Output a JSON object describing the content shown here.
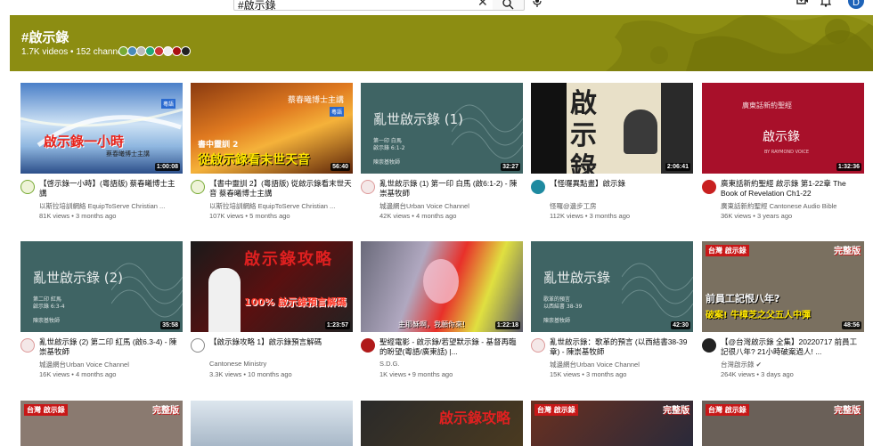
{
  "search": {
    "value": "#啟示錄"
  },
  "header": {
    "avatar_letter": "D"
  },
  "banner": {
    "title": "#啟示錄",
    "meta": "1.7K videos • 152 channels",
    "color": "#8c8d12"
  },
  "videos": [
    {
      "title": "【啓示錄一小時】(粵語版) 蔡春曦博士主講",
      "channel": "以斯拉培訓網絡 EquipToServe Christian ...",
      "meta": "81K views • 3 months ago",
      "duration": "1:00:08",
      "thumb_text": "啟示錄一小時",
      "thumb_sub": "蔡春曦博士主講",
      "thumb_badge": "粵語"
    },
    {
      "title": "【書中靈訓 2】(粵語版) 從啟示錄看末世天音 蔡春曦博士主講",
      "channel": "以斯拉培訓網絡 EquipToServe Christian ...",
      "meta": "107K views • 5 months ago",
      "duration": "56:40",
      "thumb_text": "從啟示錄看末世天音",
      "thumb_sub": "書中靈訓 2",
      "thumb_speaker": "蔡春曦博士主講",
      "thumb_badge": "粵語"
    },
    {
      "title": "亂世啟示錄 (1) 第一印 白馬 (啟6:1-2) - 陳崇基牧師",
      "channel": "城邊網台Urban Voice Channel",
      "meta": "42K views • 4 months ago",
      "duration": "32:27",
      "thumb_text": "亂世啟示錄 (1)",
      "thumb_sub": "第一印 白馬",
      "thumb_ref": "啟示錄 6:1-2",
      "thumb_author": "陳崇基牧師"
    },
    {
      "title": "【怪囉異點畫】啟示錄",
      "channel": "怪囉@邊步工房",
      "meta": "112K views • 3 months ago",
      "duration": "2:06:41",
      "thumb_text": "啟示錄"
    },
    {
      "title": "廣東話新約聖經 啟示錄 第1-22章 The Book of Revelation Ch1-22",
      "channel": "廣東話新約聖經 Cantonese Audio Bible",
      "meta": "36K views • 3 years ago",
      "duration": "1:32:36",
      "thumb_text": "啟示錄",
      "thumb_sub": "廣東話新約聖經",
      "thumb_author": "BY RAYMOND VOICE"
    },
    {
      "title": "亂世啟示錄 (2) 第二印 紅馬 (啟6.3-4) - 陳崇基牧師",
      "channel": "城邊網台Urban Voice Channel",
      "meta": "16K views • 4 months ago",
      "duration": "35:58",
      "thumb_text": "亂世啟示錄 (2)",
      "thumb_sub": "第二印 紅馬",
      "thumb_ref": "啟示錄 6:3-4",
      "thumb_author": "陳崇基牧師"
    },
    {
      "title": "【啟示錄攻略 1】啟示錄預言解碼",
      "channel": "Cantonese Ministry",
      "meta": "3.3K views • 10 months ago",
      "duration": "1:23:57",
      "thumb_text": "啟示錄攻略",
      "thumb_sub": "100% 啟示錄預言解碼"
    },
    {
      "title": "聖經電影 - 啟示錄/若望默示錄 - 基督再臨的盼望(粵語/廣東話) |...",
      "channel": "S.D.G.",
      "meta": "1K views • 9 months ago",
      "duration": "1:22:18",
      "thumb_text": "主耶穌啊，我願你來!"
    },
    {
      "title": "亂世啟示錄：歌革的預言 (以西結書38-39 章) - 陳崇基牧師",
      "channel": "城邊網台Urban Voice Channel",
      "meta": "15K views • 3 months ago",
      "duration": "42:30",
      "thumb_text": "亂世啟示錄",
      "thumb_sub": "歌革的預言",
      "thumb_ref": "以西結書 38-39",
      "thumb_author": "陳崇基牧師"
    },
    {
      "title": "【@台灣啟示錄 全集】20220717 前員工記很八年? 21小時破案過人! ...",
      "channel": "台灣啟示錄",
      "meta": "264K views • 3 days ago",
      "duration": "48:56",
      "thumb_text": "前員工記恨八年?",
      "thumb_sub": "破案! 牛樟芝之父五人中彈",
      "thumb_badge": "完整版",
      "thumb_tag": "台灣 啟示錄"
    }
  ],
  "row3": [
    {
      "thumb_tag": "台灣 啟示錄",
      "thumb_badge": "完整版"
    },
    {},
    {
      "thumb_text": "啟示錄攻略"
    },
    {
      "thumb_tag": "台灣 啟示錄",
      "thumb_badge": "完整版"
    },
    {
      "thumb_tag": "台灣 啟示錄",
      "thumb_badge": "完整版"
    }
  ]
}
